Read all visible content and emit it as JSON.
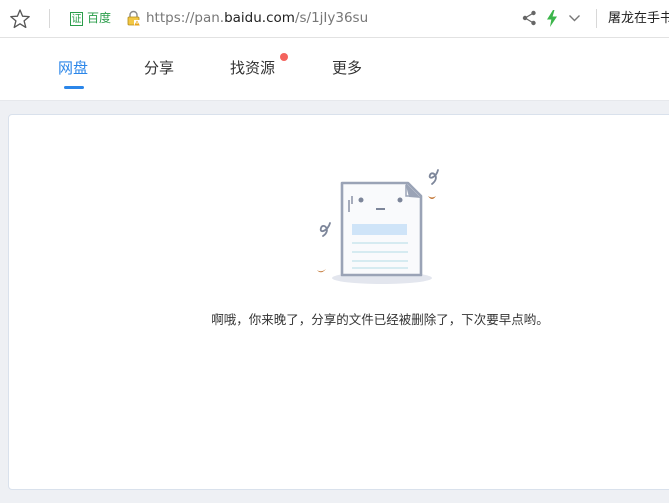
{
  "browser": {
    "cert_badge": "证",
    "cert_label": "百度",
    "url_scheme": "https://pan.",
    "url_host": "baidu.com",
    "url_path": "/s/1jIy36su",
    "search_text": "屠龙在手书",
    "icons": {
      "star": "star-icon",
      "lock": "lock-icon",
      "share": "share-icon",
      "bolt": "lightning-icon",
      "chevron": "chevron-down-icon"
    },
    "bolt_color": "#3bb54a"
  },
  "nav": {
    "items": [
      {
        "label": "网盘",
        "active": true
      },
      {
        "label": "分享",
        "active": false
      },
      {
        "label": "找资源",
        "active": false,
        "badge": "dot"
      },
      {
        "label": "更多",
        "active": false
      }
    ],
    "accent": "#2b86e9",
    "badge_color": "#f4635d"
  },
  "main": {
    "illustration": "deleted-file-illustration",
    "message": "啊哦，你来晚了，分享的文件已经被删除了，下次要早点哟。"
  }
}
